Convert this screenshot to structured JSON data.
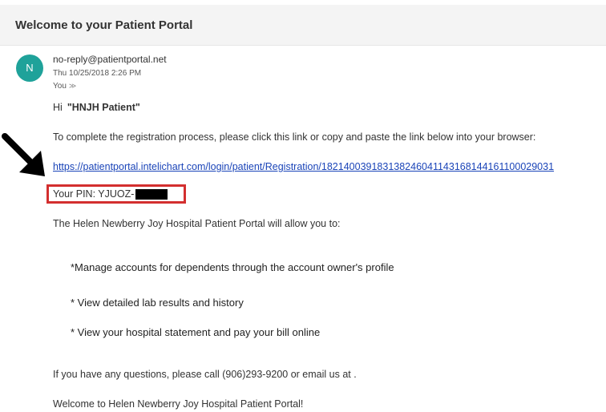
{
  "email": {
    "subject": "Welcome to your Patient Portal",
    "avatar_initial": "N",
    "sender": "no-reply@patientportal.net",
    "date": "Thu 10/25/2018 2:26 PM",
    "recipient": "You",
    "recipient_chevron": "≫",
    "greeting_prefix": "Hi",
    "patient_name": "\"HNJH Patient\"",
    "instructions": "To complete the registration process, please click this link or copy and paste the link below into your browser:",
    "registration_link": "https://patientportal.intelichart.com/login/patient/Registration/182140039183138246041143168144161100029031",
    "pin_label": "Your PIN: YJUOZ-",
    "intro": "The Helen Newberry Joy Hospital Patient Portal will allow you to:",
    "features": [
      "*Manage accounts for dependents through the account owner's profile",
      "* View detailed lab results and history",
      "* View your hospital statement and pay your bill online"
    ],
    "questions": "If you have any questions, please call (906)293-9200 or email us at .",
    "closing": "Welcome to Helen Newberry Joy Hospital Patient Portal!"
  },
  "colors": {
    "avatar": "#1fa29a",
    "link": "#1a44b8",
    "highlight_box": "#d32f2f",
    "arrow": "#000000"
  },
  "icons": {
    "annotation": "arrow-down-right-icon",
    "redaction": "redaction-bar"
  }
}
